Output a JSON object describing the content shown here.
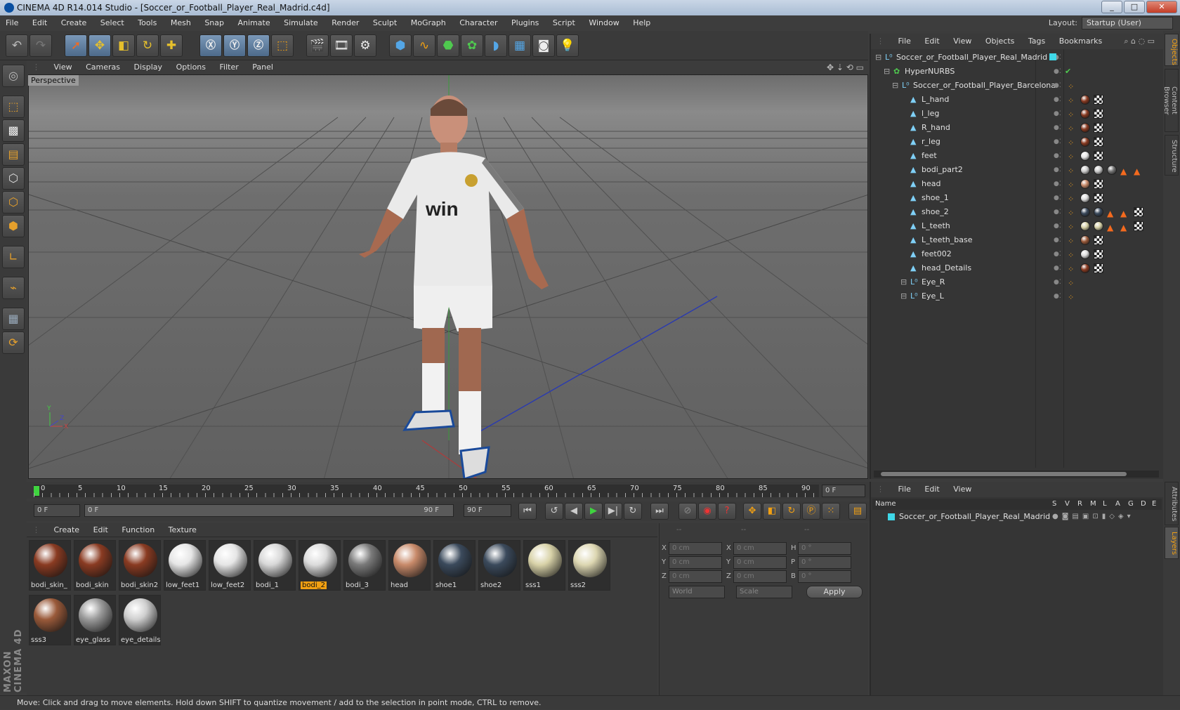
{
  "window": {
    "title": "CINEMA 4D R14.014 Studio - [Soccer_or_Football_Player_Real_Madrid.c4d]"
  },
  "menubar": [
    "File",
    "Edit",
    "Create",
    "Select",
    "Tools",
    "Mesh",
    "Snap",
    "Animate",
    "Simulate",
    "Render",
    "Sculpt",
    "MoGraph",
    "Character",
    "Plugins",
    "Script",
    "Window",
    "Help"
  ],
  "layout": {
    "label": "Layout:",
    "value": "Startup (User)"
  },
  "viewport": {
    "menu": [
      "View",
      "Cameras",
      "Display",
      "Options",
      "Filter",
      "Panel"
    ],
    "label": "Perspective",
    "axis_y": "Y",
    "axis_x": "X",
    "axis_z": "Z",
    "jersey_sponsor": "win"
  },
  "timeline": {
    "ticks": [
      "0",
      "5",
      "10",
      "15",
      "20",
      "25",
      "30",
      "35",
      "40",
      "45",
      "50",
      "55",
      "60",
      "65",
      "70",
      "75",
      "80",
      "85",
      "90"
    ],
    "current_frame": "0 F",
    "start": "0 F",
    "range_start": "0 F",
    "range_end": "90 F",
    "end": "90 F"
  },
  "materials": {
    "menu": [
      "Create",
      "Edit",
      "Function",
      "Texture"
    ],
    "items": [
      {
        "name": "bodi_skin_",
        "color": "#8a3b22"
      },
      {
        "name": "bodi_skin",
        "color": "#8a3b22"
      },
      {
        "name": "bodi_skin2",
        "color": "#8a3b22"
      },
      {
        "name": "low_feet1",
        "color": "#e6e6e6"
      },
      {
        "name": "low_feet2",
        "color": "#e6e6e6"
      },
      {
        "name": "bodi_1",
        "color": "#d8d8d8"
      },
      {
        "name": "bodi_2",
        "color": "#dcdcdc"
      },
      {
        "name": "bodi_3",
        "color": "#7a7a7a"
      },
      {
        "name": "head",
        "color": "#c88a6a"
      },
      {
        "name": "shoe1",
        "color": "#3b4a5c"
      },
      {
        "name": "shoe2",
        "color": "#3b4a5c"
      },
      {
        "name": "sss1",
        "color": "#d8d2a8"
      },
      {
        "name": "sss2",
        "color": "#ddd7b2"
      },
      {
        "name": "sss3",
        "color": "#9a5a3a"
      },
      {
        "name": "eye_glass",
        "color": "#9a9a9a"
      },
      {
        "name": "eye_details",
        "color": "#cfcfcf"
      }
    ],
    "selected": "bodi_2"
  },
  "coords": {
    "headers": [
      "--",
      "--",
      "--"
    ],
    "rows": [
      {
        "a": "X",
        "av": "0 cm",
        "b": "X",
        "bv": "0 cm",
        "c": "H",
        "cv": "0 °"
      },
      {
        "a": "Y",
        "av": "0 cm",
        "b": "Y",
        "bv": "0 cm",
        "c": "P",
        "cv": "0 °"
      },
      {
        "a": "Z",
        "av": "0 cm",
        "b": "Z",
        "bv": "0 cm",
        "c": "B",
        "cv": "0 °"
      }
    ],
    "world": "World",
    "scale": "Scale",
    "apply": "Apply"
  },
  "objects": {
    "menu": [
      "File",
      "Edit",
      "View",
      "Objects",
      "Tags",
      "Bookmarks"
    ],
    "tree": [
      {
        "name": "Soccer_or_Football_Player_Real_Madrid",
        "indent": 0,
        "icon": "null"
      },
      {
        "name": "HyperNURBS",
        "indent": 1,
        "icon": "nurbs"
      },
      {
        "name": "Soccer_or_Football_Player_Barcelona",
        "indent": 2,
        "icon": "null"
      },
      {
        "name": "L_hand",
        "indent": 3,
        "icon": "poly"
      },
      {
        "name": "l_leg",
        "indent": 3,
        "icon": "poly"
      },
      {
        "name": "R_hand",
        "indent": 3,
        "icon": "poly"
      },
      {
        "name": "r_leg",
        "indent": 3,
        "icon": "poly"
      },
      {
        "name": "feet",
        "indent": 3,
        "icon": "poly"
      },
      {
        "name": "bodi_part2",
        "indent": 3,
        "icon": "poly"
      },
      {
        "name": "head",
        "indent": 3,
        "icon": "poly"
      },
      {
        "name": "shoe_1",
        "indent": 3,
        "icon": "poly"
      },
      {
        "name": "shoe_2",
        "indent": 3,
        "icon": "poly"
      },
      {
        "name": "L_teeth",
        "indent": 3,
        "icon": "poly"
      },
      {
        "name": "L_teeth_base",
        "indent": 3,
        "icon": "poly"
      },
      {
        "name": "feet002",
        "indent": 3,
        "icon": "poly"
      },
      {
        "name": "head_Details",
        "indent": 3,
        "icon": "poly"
      },
      {
        "name": "Eye_R",
        "indent": 3,
        "icon": "null"
      },
      {
        "name": "Eye_L",
        "indent": 3,
        "icon": "null"
      }
    ]
  },
  "layers": {
    "menu": [
      "File",
      "Edit",
      "View"
    ],
    "columns": [
      "Name",
      "S",
      "V",
      "R",
      "M",
      "L",
      "A",
      "G",
      "D",
      "E"
    ],
    "rows": [
      "Soccer_or_Football_Player_Real_Madrid"
    ]
  },
  "right_tabs": [
    "Objects",
    "Content Browser",
    "Structure",
    "Attributes",
    "Layers"
  ],
  "status": "Move: Click and drag to move elements. Hold down SHIFT to quantize movement / add to the selection in point mode, CTRL to remove.",
  "brand": "MAXON CINEMA 4D"
}
